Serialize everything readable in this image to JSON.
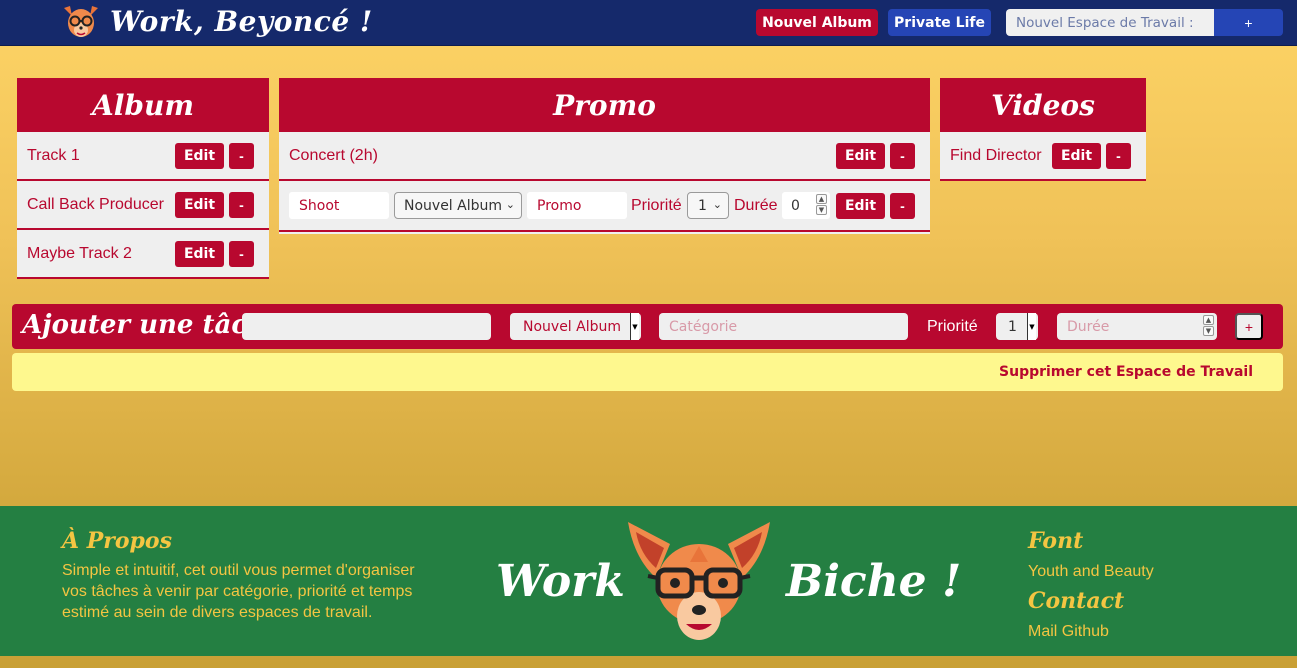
{
  "header": {
    "title": "Work, Beyoncé !",
    "logo": "deer-with-glasses-icon",
    "new_album_label": "Nouvel Album",
    "private_life_label": "Private Life",
    "workspace_placeholder": "Nouvel Espace de Travail :",
    "workspace_add_label": "+"
  },
  "columns": {
    "album": {
      "title": "Album",
      "items": [
        {
          "label": "Track 1",
          "edit": "Edit",
          "remove": "-"
        },
        {
          "label": "Call Back Producer",
          "edit": "Edit",
          "remove": "-"
        },
        {
          "label": "Maybe Track 2",
          "edit": "Edit",
          "remove": "-"
        }
      ]
    },
    "promo": {
      "title": "Promo",
      "items": [
        {
          "label": "Concert (2h)",
          "edit": "Edit",
          "remove": "-"
        }
      ],
      "editing_row": {
        "name_value": "Shoot",
        "workspace_value": "Nouvel Album",
        "category_value": "Promo",
        "priority_label": "Priorité",
        "priority_value": "1",
        "duration_label": "Durée",
        "duration_value": "0",
        "edit": "Edit",
        "remove": "-"
      }
    },
    "videos": {
      "title": "Videos",
      "items": [
        {
          "label": "Find Director",
          "edit": "Edit",
          "remove": "-"
        }
      ]
    }
  },
  "add_task": {
    "title": "Ajouter une tâche :",
    "name_placeholder": "",
    "workspace_value": "Nouvel Album",
    "category_placeholder": "Catégorie",
    "priority_label": "Priorité",
    "priority_value": "1",
    "duration_placeholder": "Durée",
    "add_label": "+"
  },
  "delete_workspace_label": "Supprimer cet Espace de Travail",
  "footer": {
    "about_title": "À Propos",
    "about_text": "Simple et intuitif, cet outil vous permet d'organiser vos tâches à venir par catégorie, priorité et temps estimé au sein de divers espaces de travail.",
    "brand_left": "Work",
    "brand_right": "Biche !",
    "font_title": "Font",
    "font_value": "Youth and Beauty",
    "contact_title": "Contact",
    "contact_links": "Mail Github"
  },
  "colors": {
    "navy": "#15296b",
    "crimson": "#b8082f",
    "blue": "#2545b5",
    "gold": "#f4c542",
    "green": "#247f42",
    "pale_yellow": "#fef88e"
  }
}
